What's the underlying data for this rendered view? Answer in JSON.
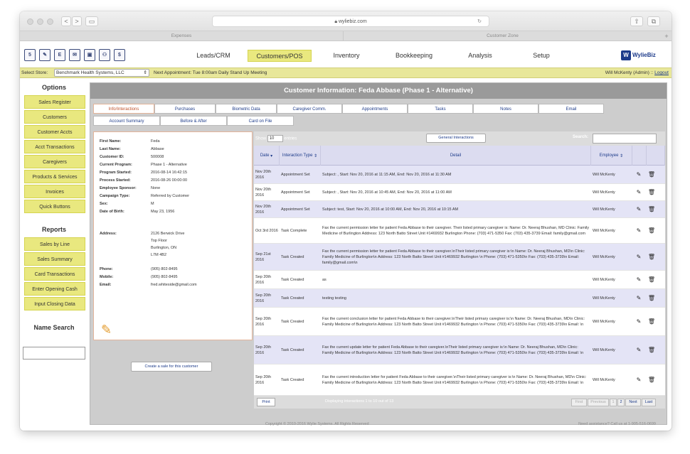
{
  "browser": {
    "url": "wyliebiz.com",
    "tabs": [
      "Expenses",
      "Customer Zone"
    ],
    "new_tab": "+",
    "back": "<",
    "forward": ">",
    "reload": "↻"
  },
  "quick_icons": [
    "5",
    "✎",
    "E",
    "✉",
    "▣",
    "⚇",
    "$"
  ],
  "nav": {
    "items": [
      "Leads/CRM",
      "Customers/POS",
      "Inventory",
      "Bookkeeping",
      "Analysis",
      "Setup"
    ],
    "active": "Customers/POS",
    "logo_text": "WylieBiz",
    "logo_mark": "W"
  },
  "storebar": {
    "select_store_label": "Select Store:",
    "store_value": "Benchmark Health Systems, LLC",
    "next_appointment": "Next Appointment: Tue 8:00am Daily Stand Up Meeting",
    "user": "Will McKenty (Admin) ::",
    "logout": "Logout"
  },
  "sidebar": {
    "options_title": "Options",
    "options": [
      "Sales Register",
      "Customers",
      "Customer Accts",
      "Acct Transactions",
      "Caregivers",
      "Products & Services",
      "Invoices",
      "Quick Buttons"
    ],
    "reports_title": "Reports",
    "reports": [
      "Sales by Line",
      "Sales Summary",
      "Card Transactions",
      "Enter Opening Cash",
      "Input Closing Data"
    ],
    "name_search_title": "Name Search"
  },
  "panel": {
    "title": "Customer Information: Feda Abbase (Phase 1 - Alternative)",
    "tabs_row1": [
      "Info/Interactions",
      "Purchases",
      "Biometric Data",
      "Caregiver Comm.",
      "Appointments",
      "Tasks",
      "Notes",
      "Email"
    ],
    "tabs_row2": [
      "Account Summary",
      "Before & After",
      "Card on File"
    ],
    "active_tab": "Info/Interactions"
  },
  "customer": {
    "fields": [
      {
        "label": "First Name:",
        "value": "Feda"
      },
      {
        "label": "Last Name:",
        "value": "Abbase"
      },
      {
        "label": "Customer ID:",
        "value": "500008"
      },
      {
        "label": "Current Program:",
        "value": "Phase 1 - Alternative"
      },
      {
        "label": "Program Started:",
        "value": "2016-08-14 16:42:15"
      },
      {
        "label": "Process Started:",
        "value": "2016-08-26 00:00:00"
      },
      {
        "label": "Employee Sponsor:",
        "value": "None"
      },
      {
        "label": "Campaign Type:",
        "value": "Referred by Customer"
      },
      {
        "label": "Sex:",
        "value": "M"
      },
      {
        "label": "Date of Birth:",
        "value": "May 23, 1956"
      }
    ],
    "address_label": "Address:",
    "address_lines": [
      "2126 Berwick Drive",
      "Top Floor",
      "Burlington, ON",
      "L7M 4B2"
    ],
    "contacts": [
      {
        "label": "Phone:",
        "value": "(905) 802-8495"
      },
      {
        "label": "Mobile:",
        "value": "(905) 802-8495"
      },
      {
        "label": "Email:",
        "value": "fred.whiteside@gmail.com"
      }
    ],
    "create_sale": "Create a sale for this customer"
  },
  "table": {
    "show_label": "Show",
    "show_value": "10",
    "entries_label": "entries",
    "general_button": "General Interactions",
    "search_label": "Search:",
    "headers": [
      "Date",
      "Interaction Type",
      "Detail",
      "Employee"
    ],
    "rows": [
      {
        "date": "Nov 20th 2016",
        "type": "Appointment Set",
        "detail": "Subject: , Start: Nov 20, 2016 at 11:15 AM, End: Nov 20, 2016 at 11:30 AM",
        "employee": "Will McKenty"
      },
      {
        "date": "Nov 20th 2016",
        "type": "Appointment Set",
        "detail": "Subject: , Start: Nov 20, 2016 at 10:45 AM, End: Nov 20, 2016 at 11:00 AM",
        "employee": "Will McKenty"
      },
      {
        "date": "Nov 20th 2016",
        "type": "Appointment Set",
        "detail": "Subject: test, Start: Nov 20, 2016 at 10:00 AM, End: Nov 20, 2016 at 10:15 AM",
        "employee": "Will McKenty"
      },
      {
        "date": "Oct 3rd 2016",
        "type": "Task Complete",
        "detail": "Fax the current permission letter for patient Feda Abbase to their caregiver. Their listed primary caregiver is: Name: Dr. Neeraj Bhushan, MD Clinic: Family Medicine of Burlington Address: 123 North Batto Street Unit #1469932 Burlington Phone: (703) 471-5350 Fax: (703) 435-3739 Email: family@gmail.com",
        "employee": "Will McKenty"
      },
      {
        "date": "Sep 21st 2016",
        "type": "Task Created",
        "detail": "Fax the current permission letter for patient Feda Abbase to their caregiver.\\nTheir listed primary caregiver is:\\n Name: Dr. Neeraj Bhushan, MD\\n Clinic: Family Medicine of Burlington\\n Address: 123 North Batto Street Unit #1469932 Burlington \\n Phone: (703) 471-5350\\n Fax: (703) 435-3739\\n Email: family@gmail.com\\n",
        "employee": "Will McKenty"
      },
      {
        "date": "Sep 20th 2016",
        "type": "Task Created",
        "detail": "as",
        "employee": "Will McKenty"
      },
      {
        "date": "Sep 20th 2016",
        "type": "Task Created",
        "detail": "testing testing",
        "employee": "Will McKenty"
      },
      {
        "date": "Sep 20th 2016",
        "type": "Task Created",
        "detail": "Fax the current conclusion letter for patient Feda Abbase to their caregiver.\\nTheir listed primary caregiver is:\\n Name: Dr. Neeraj Bhushan, MD\\n Clinic: Family Medicine of Burlington\\n Address: 123 North Batto Street Unit #1469932 Burlington \\n Phone: (703) 471-5350\\n Fax: (703) 435-3739\\n Email: \\n",
        "employee": "Will McKenty"
      },
      {
        "date": "Sep 20th 2016",
        "type": "Task Created",
        "detail": "Fax the current update letter for patient Feda Abbase to their caregiver.\\nTheir listed primary caregiver is:\\n Name: Dr. Neeraj Bhushan, MD\\n Clinic: Family Medicine of Burlington\\n Address: 123 North Batto Street Unit #1469932 Burlington \\n Phone: (703) 471-5350\\n Fax: (703) 435-3739\\n Email: \\n",
        "employee": "Will McKenty"
      },
      {
        "date": "Sep 20th 2016",
        "type": "Task Created",
        "detail": "Fax the current introduction letter for patient Feda Abbase to their caregiver.\\nTheir listed primary caregiver is:\\n Name: Dr. Neeraj Bhushan, MD\\n Clinic: Family Medicine of Burlington\\n Address: 123 North Batto Street Unit #1469932 Burlington \\n Phone: (703) 471-5350\\n Fax: (703) 435-3739\\n Email: \\n",
        "employee": "Will McKenty"
      }
    ],
    "print": "Print",
    "displaying": "Displaying interactions 1 to 10 out of 13",
    "pager": [
      "First",
      "Previous",
      "1",
      "2",
      "Next",
      "Last"
    ]
  },
  "footer": {
    "copyright": "Copyright © 2010-2016 Wylie Systems. All Rights Reserved",
    "help": "Need assistance? Call us at 1-905-516-0699"
  }
}
